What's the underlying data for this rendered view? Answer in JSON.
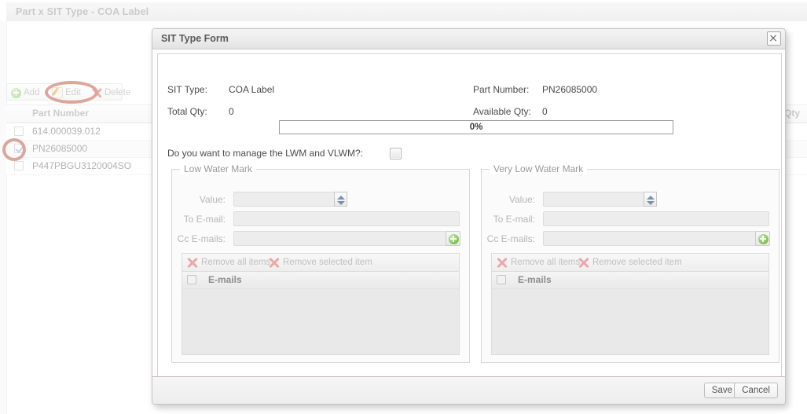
{
  "background": {
    "page_title": "Part x SIT Type - COA Label",
    "toolbar": {
      "add_label": "Add",
      "edit_label": "Edit",
      "delete_label": "Delete"
    },
    "table": {
      "columns": [
        "Part Number",
        "Qty"
      ],
      "rows": [
        {
          "checked": false,
          "part_number": "614.000039.012"
        },
        {
          "checked": true,
          "part_number": "PN26085000"
        },
        {
          "checked": false,
          "part_number": "P447PBGU3120004SO"
        }
      ]
    },
    "annotation_color": "#b23a22"
  },
  "dialog": {
    "title": "SIT Type Form",
    "close_label": "",
    "summary": {
      "sit_type_label": "SIT Type:",
      "sit_type_value": "COA Label",
      "total_qty_label": "Total Qty:",
      "total_qty_value": "0",
      "part_number_label": "Part Number:",
      "part_number_value": "PN26085000",
      "available_qty_label": "Available Qty:",
      "available_qty_value": "0"
    },
    "progress": {
      "percent_text": "0%",
      "percent": 0
    },
    "manage_question": "Do you want to manage the LWM and VLWM?:",
    "manage_toggle_checked": false,
    "low_water_mark": {
      "legend": "Low Water Mark",
      "value_label": "Value:",
      "value": "",
      "to_email_label": "To E-mail:",
      "to_email": "",
      "cc_emails_label": "Cc E-mails:",
      "cc_emails": "",
      "add_cc_label": "",
      "remove_all_label": "Remove all items",
      "remove_selected_label": "Remove selected item",
      "grid_column": "E-mails",
      "grid_rows": []
    },
    "very_low_water_mark": {
      "legend": "Very Low Water Mark",
      "value_label": "Value:",
      "value": "",
      "to_email_label": "To E-mail:",
      "to_email": "",
      "cc_emails_label": "Cc E-mails:",
      "cc_emails": "",
      "add_cc_label": "",
      "remove_all_label": "Remove all items",
      "remove_selected_label": "Remove selected item",
      "grid_column": "E-mails",
      "grid_rows": []
    },
    "footer": {
      "save_label": "Save",
      "cancel_label": "Cancel"
    }
  }
}
